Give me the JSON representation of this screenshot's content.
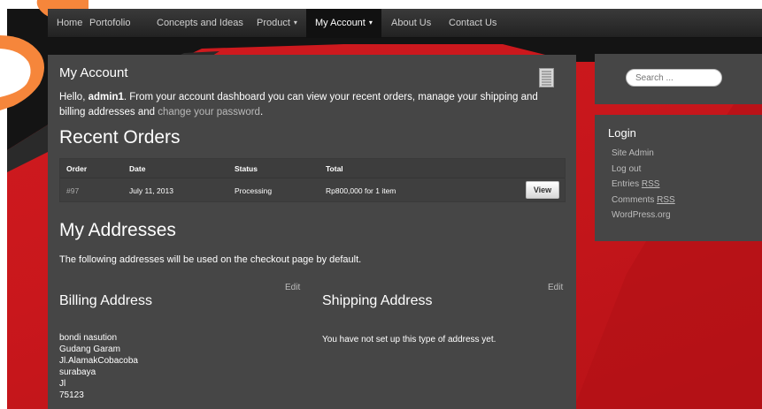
{
  "nav": {
    "items": [
      {
        "label": "Home"
      },
      {
        "label": "Portofolio"
      },
      {
        "label": "Concepts and Ideas"
      },
      {
        "label": "Product"
      },
      {
        "label": "My Account"
      },
      {
        "label": "About Us"
      },
      {
        "label": "Contact Us"
      }
    ],
    "caret": "▾"
  },
  "account": {
    "title": "My Account",
    "intro_hello": "Hello, ",
    "intro_user": "admin1",
    "intro_text": ". From your account dashboard you can view your recent orders, manage your shipping and billing addresses and ",
    "intro_link": "change your password",
    "intro_end": "."
  },
  "orders": {
    "heading": "Recent Orders",
    "columns": [
      "Order",
      "Date",
      "Status",
      "Total"
    ],
    "rows": [
      {
        "order": "#97",
        "date": "July 11, 2013",
        "status": "Processing",
        "total": "Rp800,000 for 1 item",
        "action": "View"
      }
    ]
  },
  "addresses": {
    "heading": "My Addresses",
    "note": "The following addresses will be used on the checkout page by default.",
    "billing": {
      "title": "Billing Address",
      "edit": "Edit",
      "lines": [
        "bondi nasution",
        "Gudang Garam",
        "Jl.AlamakCobacoba",
        "surabaya",
        "Jl",
        "75123"
      ]
    },
    "shipping": {
      "title": "Shipping Address",
      "edit": "Edit",
      "note": "You have not set up this type of address yet."
    }
  },
  "sidebar": {
    "search_placeholder": "Search ...",
    "login": {
      "title": "Login",
      "links": [
        "Site Admin",
        "Log out",
        "Entries ",
        "Comments ",
        "WordPress.org"
      ],
      "rss": "RSS"
    }
  },
  "colors": {
    "background_red": "#c9171c",
    "panel": "#464646",
    "nav": "#222222",
    "accent_orange": "#f07a3a"
  }
}
